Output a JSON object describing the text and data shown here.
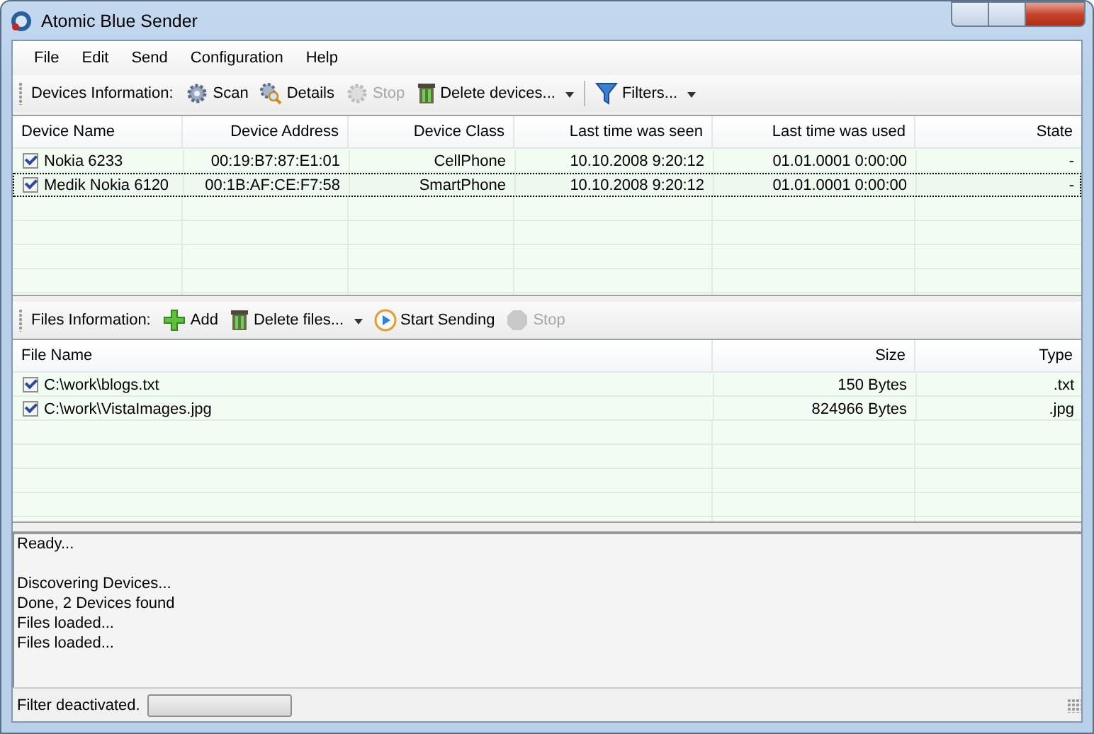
{
  "window": {
    "title": "Atomic Blue Sender"
  },
  "menu": [
    "File",
    "Edit",
    "Send",
    "Configuration",
    "Help"
  ],
  "devices": {
    "toolbar": {
      "title": "Devices Information:",
      "items": [
        {
          "label": "Scan",
          "kind": "scan",
          "disabled": false,
          "dropdown": false
        },
        {
          "label": "Details",
          "kind": "details",
          "disabled": false,
          "dropdown": false
        },
        {
          "label": "Stop",
          "kind": "halt",
          "disabled": true,
          "dropdown": false
        },
        {
          "label": "Delete devices...",
          "kind": "delete",
          "disabled": false,
          "dropdown": true
        },
        {
          "label": "Filters...",
          "kind": "filter",
          "disabled": false,
          "dropdown": true
        }
      ]
    },
    "table": {
      "columns": [
        "Device Name",
        "Device Address",
        "Device Class",
        "Last time was seen",
        "Last time was used",
        "State"
      ],
      "rows": [
        {
          "checked": true,
          "focused": false,
          "cells": [
            "Nokia 6233",
            "00:19:B7:87:E1:01",
            "CellPhone",
            "10.10.2008 9:20:12",
            "01.01.0001 0:00:00",
            "-"
          ]
        },
        {
          "checked": true,
          "focused": true,
          "cells": [
            "Medik Nokia 6120",
            "00:1B:AF:CE:F7:58",
            "SmartPhone",
            "10.10.2008 9:20:12",
            "01.01.0001 0:00:00",
            "-"
          ]
        }
      ]
    }
  },
  "files": {
    "toolbar": {
      "title": "Files Information:",
      "items": [
        {
          "label": "Add",
          "kind": "add",
          "disabled": false,
          "dropdown": false
        },
        {
          "label": "Delete files...",
          "kind": "delete",
          "disabled": false,
          "dropdown": true
        },
        {
          "label": "Start Sending",
          "kind": "send",
          "disabled": false,
          "dropdown": false
        },
        {
          "label": "Stop",
          "kind": "stopsign",
          "disabled": true,
          "dropdown": false
        }
      ]
    },
    "table": {
      "columns": [
        "File Name",
        "Size",
        "Type"
      ],
      "rows": [
        {
          "checked": true,
          "focused": false,
          "cells": [
            "C:\\work\\blogs.txt",
            "150 Bytes",
            ".txt"
          ]
        },
        {
          "checked": true,
          "focused": false,
          "cells": [
            "C:\\work\\VistaImages.jpg",
            "824966 Bytes",
            ".jpg"
          ]
        }
      ]
    }
  },
  "log": [
    [
      "Ready..."
    ],
    [
      "Discovering Devices...",
      "Done, 2 Devices found",
      "Files loaded...",
      "Files loaded..."
    ]
  ],
  "status_bar": {
    "text": "Filter deactivated.",
    "progress": {
      "level": 0
    }
  }
}
